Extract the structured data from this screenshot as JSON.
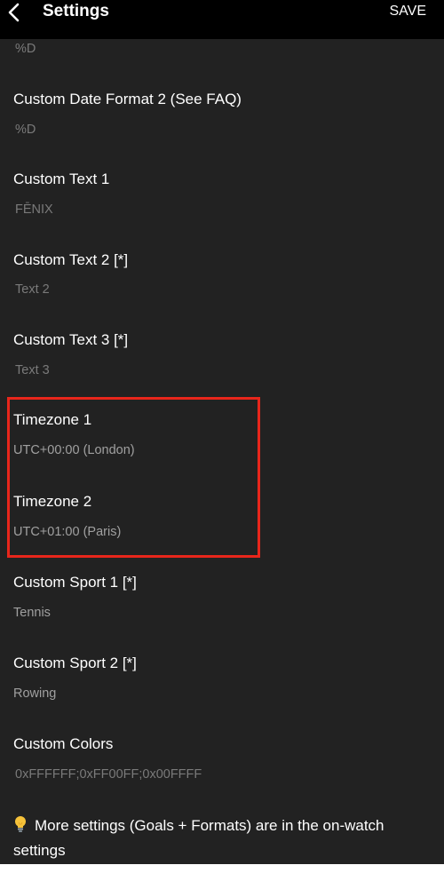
{
  "header": {
    "title": "Settings",
    "save_label": "SAVE"
  },
  "settings": [
    {
      "label": "",
      "value": "%D"
    },
    {
      "label": "Custom Date Format 2 (See FAQ)",
      "value": "%D"
    },
    {
      "label": "Custom Text 1",
      "value": "FĒNIX"
    },
    {
      "label": "Custom Text 2 [*]",
      "value": "Text 2"
    },
    {
      "label": "Custom Text 3 [*]",
      "value": "Text 3"
    },
    {
      "label": "Timezone 1",
      "value": "UTC+00:00 (London)"
    },
    {
      "label": "Timezone 2",
      "value": "UTC+01:00 (Paris)"
    },
    {
      "label": "Custom Sport 1 [*]",
      "value": "Tennis"
    },
    {
      "label": "Custom Sport 2 [*]",
      "value": "Rowing"
    },
    {
      "label": "Custom Colors",
      "value": "0xFFFFFF;0xFF00FF;0x00FFFF"
    }
  ],
  "footer_note": "More settings (Goals + Formats) are in the on-watch settings",
  "icons": {
    "back": "chevron-left-icon",
    "note": "lightbulb-icon"
  },
  "colors": {
    "highlight": "#e8261b",
    "background": "#222222",
    "topbar": "#000000"
  }
}
